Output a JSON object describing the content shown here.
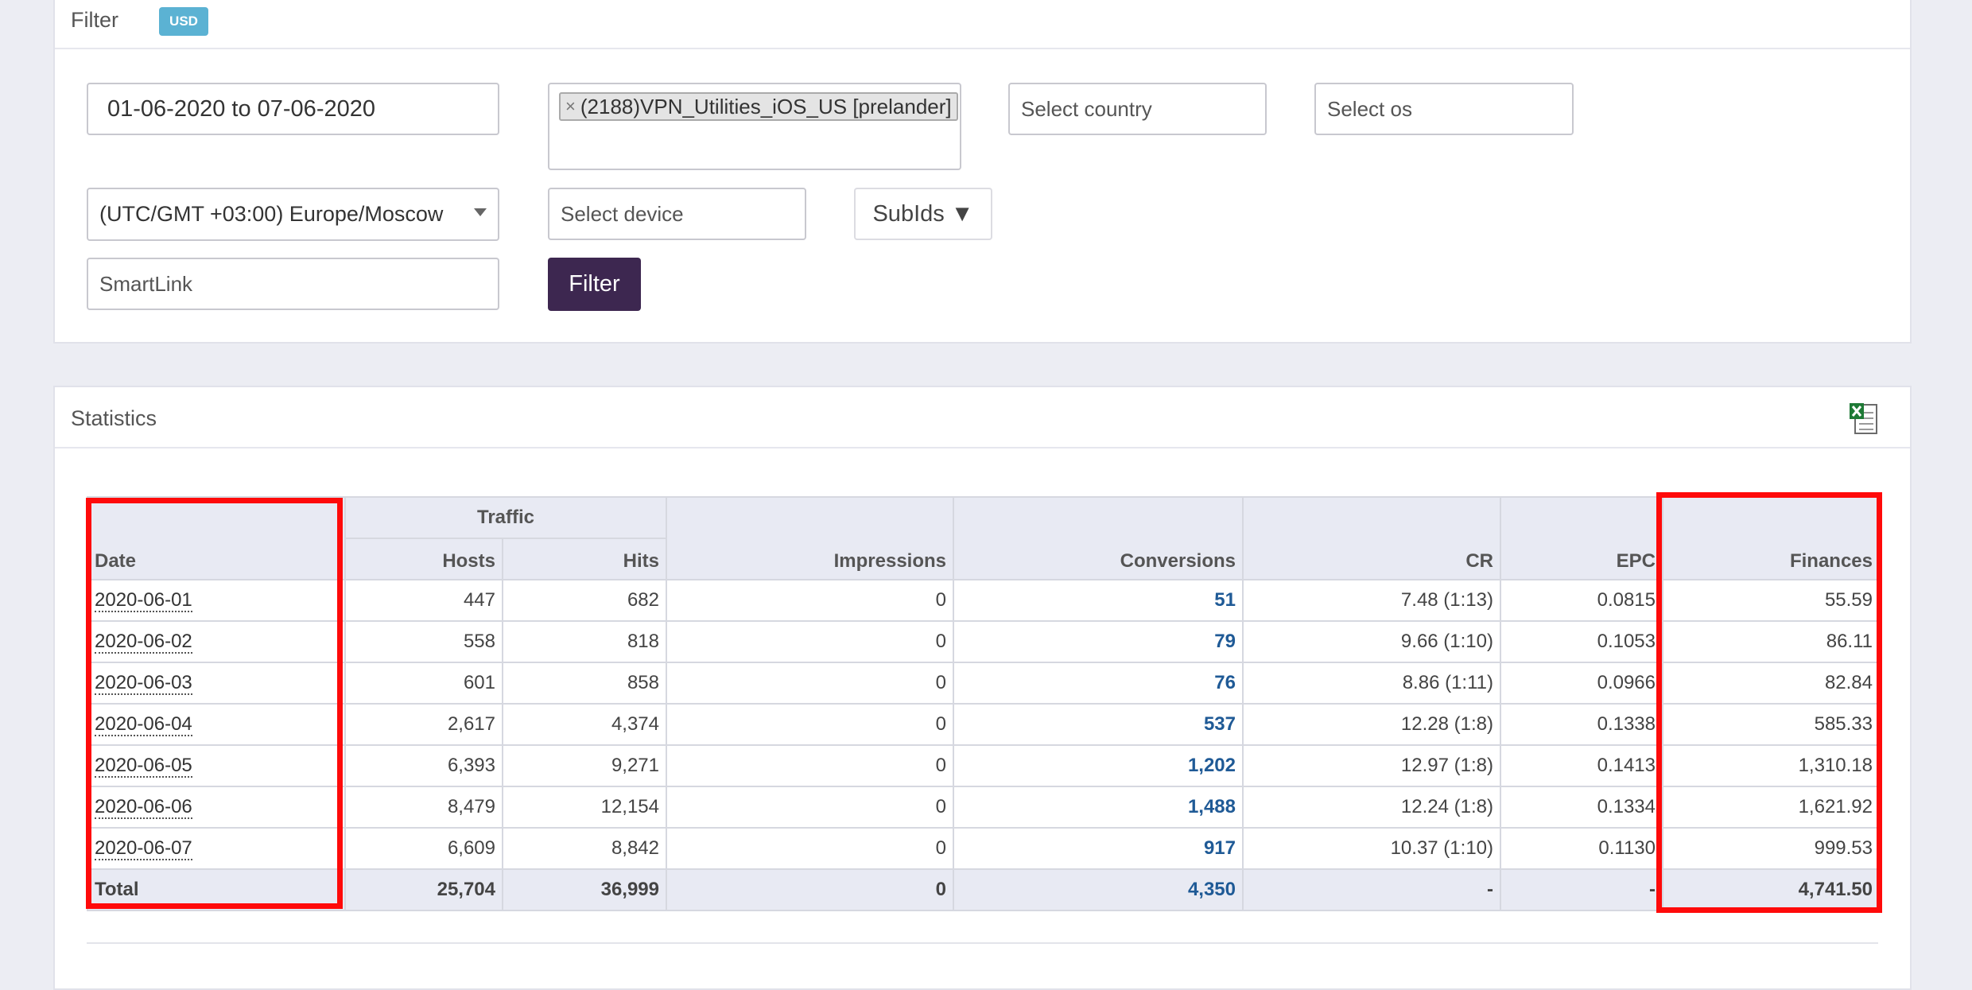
{
  "filter": {
    "title": "Filter",
    "currency_badge": "USD",
    "date_range": "01-06-2020 to 07-06-2020",
    "offer_tag": "(2188)VPN_Utilities_iOS_US [prelander]",
    "offer_tag_remove": "×",
    "country_placeholder": "Select country",
    "os_placeholder": "Select os",
    "timezone": "(UTC/GMT +03:00) Europe/Moscow",
    "device_placeholder": "Select device",
    "subids_label": "SubIds ▼",
    "smartlink_placeholder": "SmartLink",
    "filter_button": "Filter"
  },
  "statistics": {
    "title": "Statistics",
    "export_icon": "excel-export-icon",
    "headers": {
      "traffic": "Traffic",
      "date": "Date",
      "hosts": "Hosts",
      "hits": "Hits",
      "impressions": "Impressions",
      "conversions": "Conversions",
      "cr": "CR",
      "epc": "EPC",
      "finances": "Finances"
    },
    "rows": [
      {
        "date": "2020-06-01",
        "hosts": "447",
        "hits": "682",
        "impressions": "0",
        "conversions": "51",
        "cr": "7.48 (1:13)",
        "epc": "0.0815",
        "finances": "55.59"
      },
      {
        "date": "2020-06-02",
        "hosts": "558",
        "hits": "818",
        "impressions": "0",
        "conversions": "79",
        "cr": "9.66 (1:10)",
        "epc": "0.1053",
        "finances": "86.11"
      },
      {
        "date": "2020-06-03",
        "hosts": "601",
        "hits": "858",
        "impressions": "0",
        "conversions": "76",
        "cr": "8.86 (1:11)",
        "epc": "0.0966",
        "finances": "82.84"
      },
      {
        "date": "2020-06-04",
        "hosts": "2,617",
        "hits": "4,374",
        "impressions": "0",
        "conversions": "537",
        "cr": "12.28 (1:8)",
        "epc": "0.1338",
        "finances": "585.33"
      },
      {
        "date": "2020-06-05",
        "hosts": "6,393",
        "hits": "9,271",
        "impressions": "0",
        "conversions": "1,202",
        "cr": "12.97 (1:8)",
        "epc": "0.1413",
        "finances": "1,310.18"
      },
      {
        "date": "2020-06-06",
        "hosts": "8,479",
        "hits": "12,154",
        "impressions": "0",
        "conversions": "1,488",
        "cr": "12.24 (1:8)",
        "epc": "0.1334",
        "finances": "1,621.92"
      },
      {
        "date": "2020-06-07",
        "hosts": "6,609",
        "hits": "8,842",
        "impressions": "0",
        "conversions": "917",
        "cr": "10.37 (1:10)",
        "epc": "0.1130",
        "finances": "999.53"
      }
    ],
    "total": {
      "label": "Total",
      "hosts": "25,704",
      "hits": "36,999",
      "impressions": "0",
      "conversions": "4,350",
      "cr": "-",
      "epc": "-",
      "finances": "4,741.50"
    }
  },
  "colors": {
    "highlight": "#ff0a0a",
    "filter_button": "#3d2750",
    "badge": "#5bb2d3",
    "conversions_link": "#1f5a96"
  }
}
